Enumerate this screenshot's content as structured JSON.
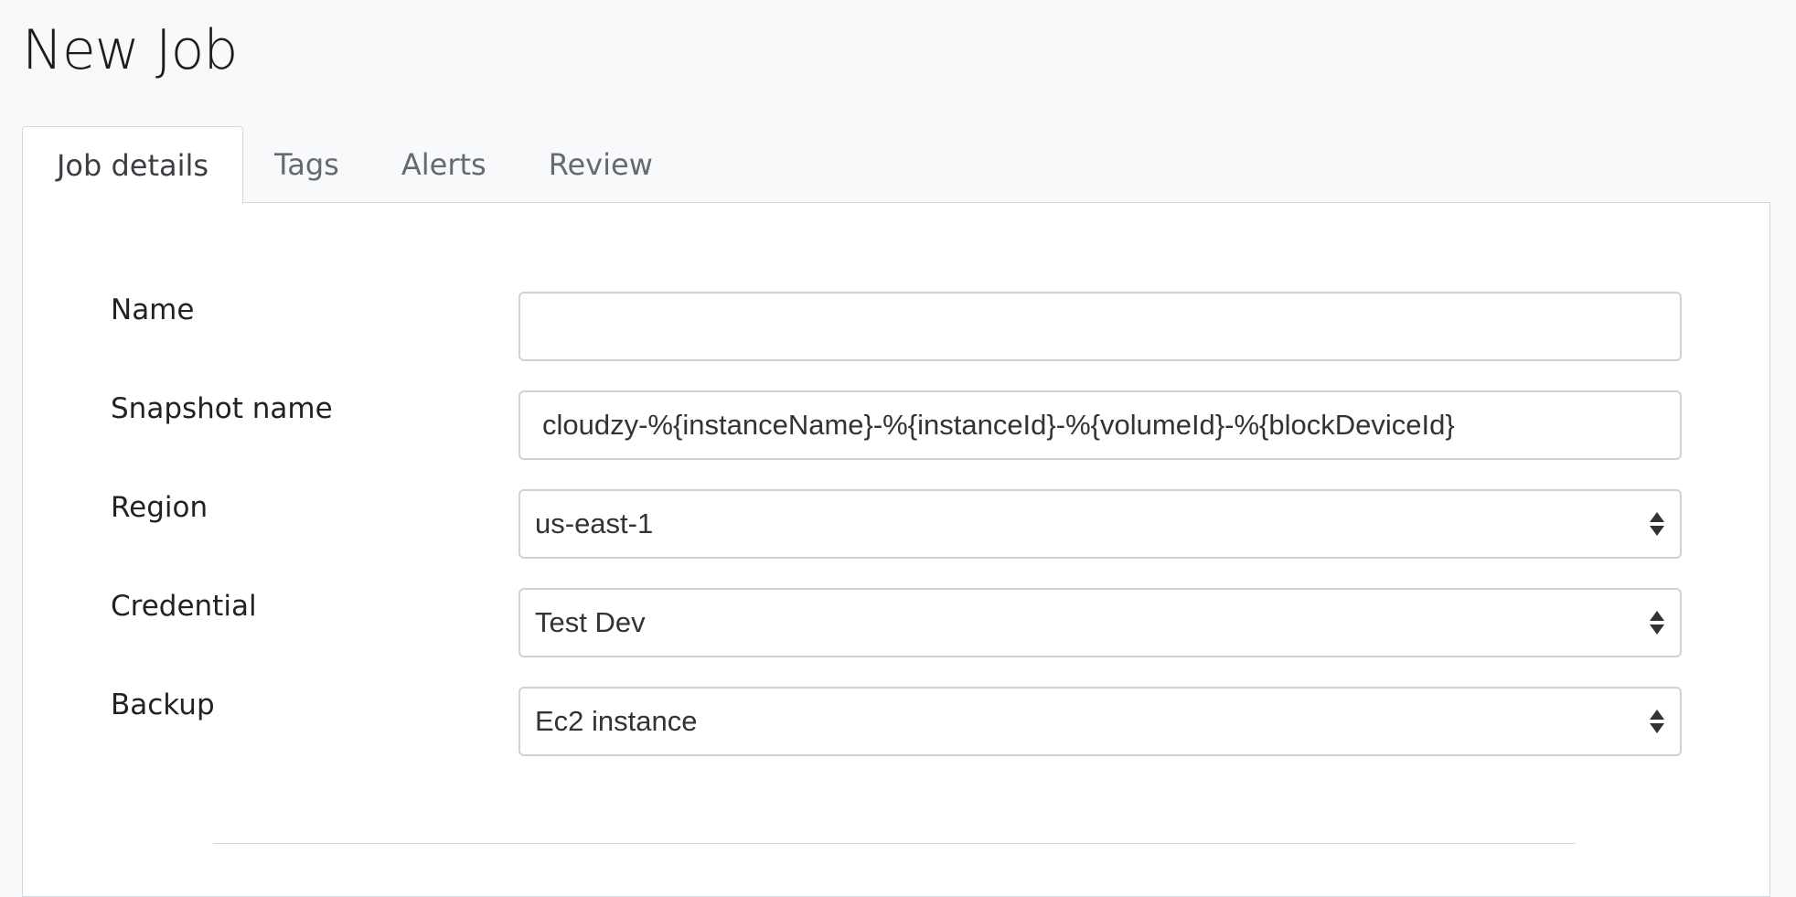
{
  "page": {
    "title": "New Job"
  },
  "tabs": [
    {
      "label": "Job details",
      "active": true
    },
    {
      "label": "Tags",
      "active": false
    },
    {
      "label": "Alerts",
      "active": false
    },
    {
      "label": "Review",
      "active": false
    }
  ],
  "form": {
    "name": {
      "label": "Name",
      "value": "",
      "placeholder": ""
    },
    "snapshot_name": {
      "label": "Snapshot name",
      "value": "cloudzy-%{instanceName}-%{instanceId}-%{volumeId}-%{blockDeviceId}"
    },
    "region": {
      "label": "Region",
      "value": "us-east-1"
    },
    "credential": {
      "label": "Credential",
      "value": "Test Dev"
    },
    "backup": {
      "label": "Backup",
      "value": "Ec2 instance"
    }
  },
  "icons": {
    "select_arrows": "up-down-arrows-icon"
  }
}
